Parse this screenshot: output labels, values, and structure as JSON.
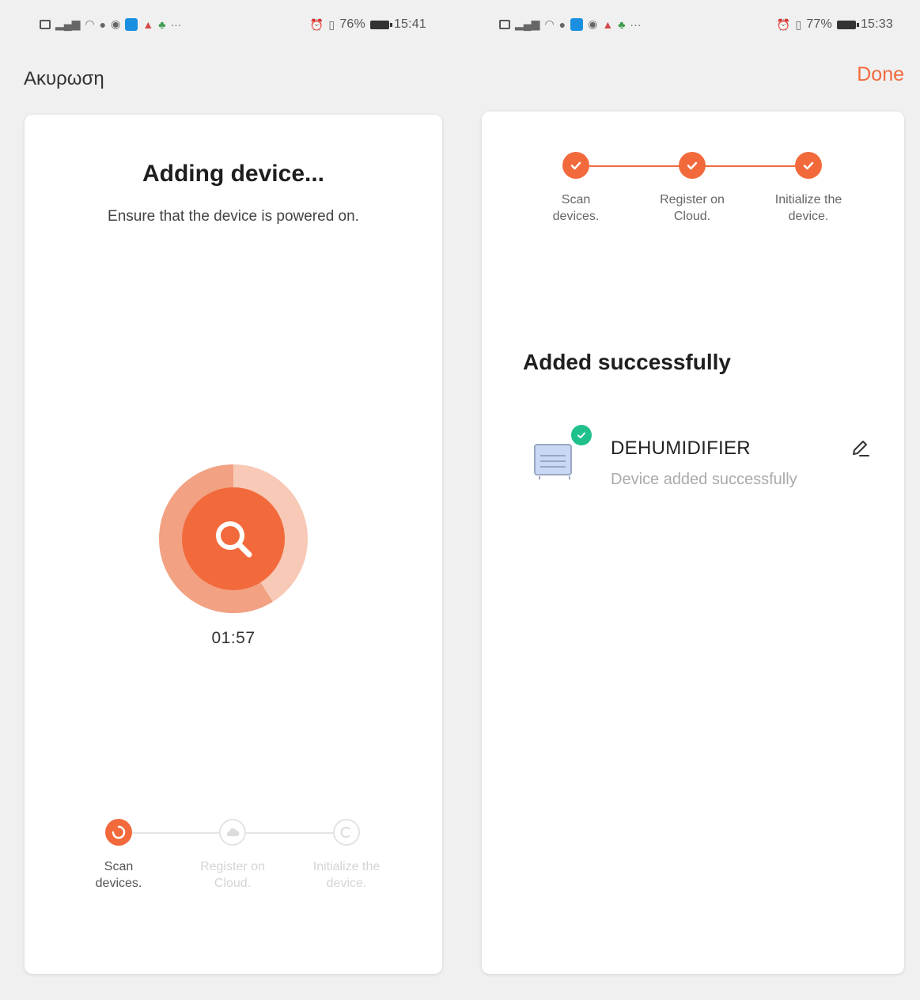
{
  "left_screen": {
    "status_bar": {
      "battery_percent": "76%",
      "time": "15:41"
    },
    "cancel_link": "Ακυρωση",
    "title": "Adding device...",
    "subtitle": "Ensure that the device is powered on.",
    "scan_progress": 0.59,
    "timer": "01:57",
    "steps": [
      {
        "label_line1": "Scan",
        "label_line2": "devices.",
        "state": "active"
      },
      {
        "label_line1": "Register on",
        "label_line2": "Cloud.",
        "state": "pending"
      },
      {
        "label_line1": "Initialize the",
        "label_line2": "device.",
        "state": "pending"
      }
    ]
  },
  "right_screen": {
    "status_bar": {
      "battery_percent": "77%",
      "time": "15:33"
    },
    "done_link": "Done",
    "steps": [
      {
        "label_line1": "Scan",
        "label_line2": "devices.",
        "state": "done"
      },
      {
        "label_line1": "Register on",
        "label_line2": "Cloud.",
        "state": "done"
      },
      {
        "label_line1": "Initialize the",
        "label_line2": "device.",
        "state": "done"
      }
    ],
    "success_heading": "Added successfully",
    "device": {
      "name": "DEHUMIDIFIER",
      "status": "Device added successfully"
    }
  },
  "colors": {
    "accent": "#f26a3c",
    "accent_light": "#f7c9b6",
    "success": "#20c08c",
    "muted": "#d9d9d9"
  },
  "icons": {
    "scan": "magnifier-icon",
    "step_done": "check-icon",
    "edit": "pencil-icon",
    "device_badge": "check-badge-icon"
  }
}
